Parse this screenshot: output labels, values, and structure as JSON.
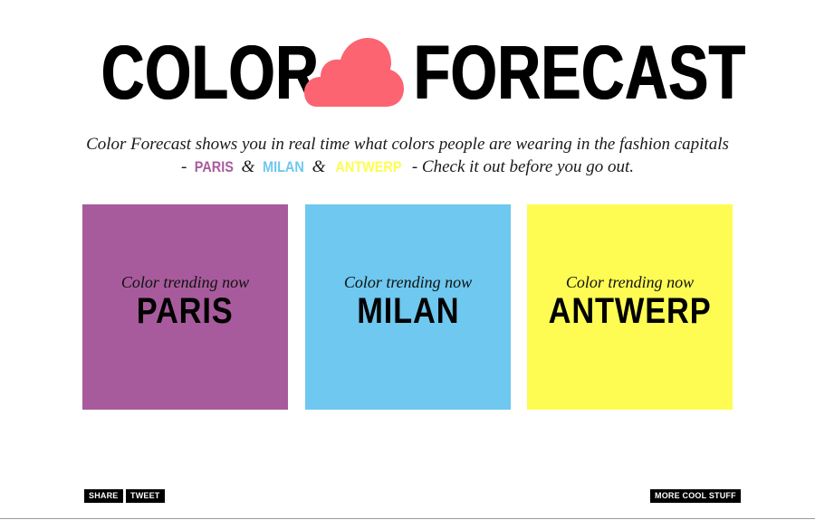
{
  "header": {
    "title_left": "COLOR",
    "title_right": "FORECAST",
    "logo_icon": "cloud-icon",
    "cloud_color": "#fc6472"
  },
  "tagline": {
    "part1": "Color Forecast shows you in real time what colors people are wearing in the fashion capitals - ",
    "city1": "PARIS",
    "amp1": " & ",
    "city2": "MILAN",
    "amp2": " & ",
    "city3": "ANTWERP",
    "part2": " - Check it out before you go out."
  },
  "cards": [
    {
      "subtitle": "Color trending now",
      "city": "PARIS",
      "color": "#a85b9c"
    },
    {
      "subtitle": "Color trending now",
      "city": "MILAN",
      "color": "#6ec8ef"
    },
    {
      "subtitle": "Color trending now",
      "city": "ANTWERP",
      "color": "#fefc53"
    }
  ],
  "footer": {
    "share_label": "SHARE",
    "tweet_label": "TWEET",
    "more_label": "MORE COOL STUFF"
  },
  "colors": {
    "paris": "#a85b9c",
    "milan": "#6ec8ef",
    "antwerp": "#fefc53",
    "cloud": "#fc6472"
  }
}
